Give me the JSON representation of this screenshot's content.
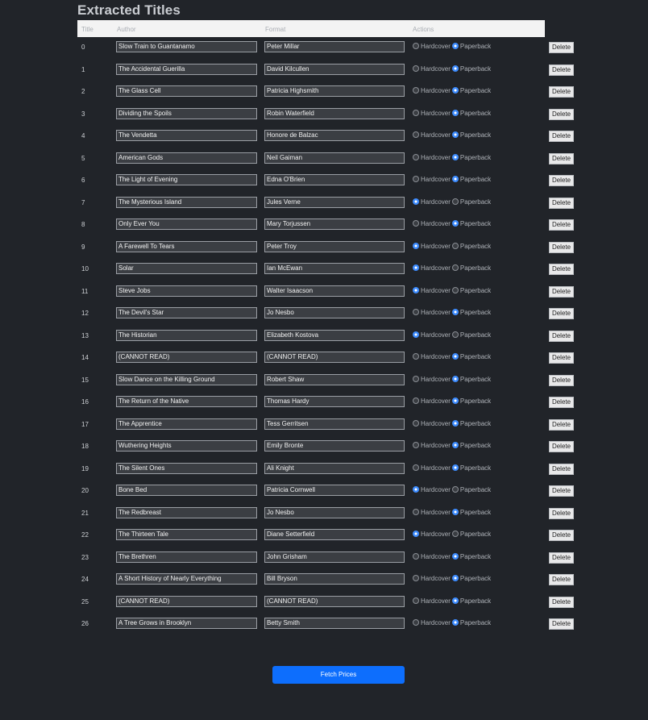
{
  "page": {
    "title": "Extracted Titles",
    "columns": [
      "Title",
      "Author",
      "Format",
      "Actions"
    ],
    "hardcover_label": "Hardcover",
    "paperback_label": "Paperback",
    "delete_label": "Delete",
    "fetch_label": "Fetch Prices"
  },
  "books": [
    {
      "index": "0",
      "title": "Slow Train to Guantanamo",
      "author": "Peter Millar",
      "format": "Paperback"
    },
    {
      "index": "1",
      "title": "The Accidental Guerilla",
      "author": "David Kilcullen",
      "format": "Paperback"
    },
    {
      "index": "2",
      "title": "The Glass Cell",
      "author": "Patricia Highsmith",
      "format": "Paperback"
    },
    {
      "index": "3",
      "title": "Dividing the Spoils",
      "author": "Robin Waterfield",
      "format": "Paperback"
    },
    {
      "index": "4",
      "title": "The Vendetta",
      "author": "Honore de Balzac",
      "format": "Paperback"
    },
    {
      "index": "5",
      "title": "American Gods",
      "author": "Neil Gaiman",
      "format": "Paperback"
    },
    {
      "index": "6",
      "title": "The Light of Evening",
      "author": "Edna O'Brien",
      "format": "Paperback"
    },
    {
      "index": "7",
      "title": "The Mysterious Island",
      "author": "Jules Verne",
      "format": "Hardcover"
    },
    {
      "index": "8",
      "title": "Only Ever You",
      "author": "Mary Torjussen",
      "format": "Paperback"
    },
    {
      "index": "9",
      "title": "A Farewell To Tears",
      "author": "Peter Troy",
      "format": "Hardcover"
    },
    {
      "index": "10",
      "title": "Solar",
      "author": "Ian McEwan",
      "format": "Hardcover"
    },
    {
      "index": "11",
      "title": "Steve Jobs",
      "author": "Walter Isaacson",
      "format": "Hardcover"
    },
    {
      "index": "12",
      "title": "The Devil's Star",
      "author": "Jo Nesbo",
      "format": "Paperback"
    },
    {
      "index": "13",
      "title": "The Historian",
      "author": "Elizabeth Kostova",
      "format": "Hardcover"
    },
    {
      "index": "14",
      "title": "(CANNOT READ)",
      "author": "(CANNOT READ)",
      "format": "Paperback"
    },
    {
      "index": "15",
      "title": "Slow Dance on the Killing Ground",
      "author": "Robert Shaw",
      "format": "Paperback"
    },
    {
      "index": "16",
      "title": "The Return of the Native",
      "author": "Thomas Hardy",
      "format": "Paperback"
    },
    {
      "index": "17",
      "title": "The Apprentice",
      "author": "Tess Gerritsen",
      "format": "Paperback"
    },
    {
      "index": "18",
      "title": "Wuthering Heights",
      "author": "Emily Bronte",
      "format": "Paperback"
    },
    {
      "index": "19",
      "title": "The Silent Ones",
      "author": "Ali Knight",
      "format": "Paperback"
    },
    {
      "index": "20",
      "title": "Bone Bed",
      "author": "Patricia Cornwell",
      "format": "Hardcover"
    },
    {
      "index": "21",
      "title": "The Redbreast",
      "author": "Jo Nesbo",
      "format": "Paperback"
    },
    {
      "index": "22",
      "title": "The Thirteen Tale",
      "author": "Diane Setterfield",
      "format": "Hardcover"
    },
    {
      "index": "23",
      "title": "The Brethren",
      "author": "John Grisham",
      "format": "Paperback"
    },
    {
      "index": "24",
      "title": "A Short History of Nearly Everything",
      "author": "Bill Bryson",
      "format": "Paperback"
    },
    {
      "index": "25",
      "title": "(CANNOT READ)",
      "author": "(CANNOT READ)",
      "format": "Paperback"
    },
    {
      "index": "26",
      "title": "A Tree Grows in Brooklyn",
      "author": "Betty Smith",
      "format": "Paperback"
    }
  ],
  "colors": {
    "background": "#212429",
    "header": "#f3f3f3",
    "accent": "#0d6efd"
  }
}
